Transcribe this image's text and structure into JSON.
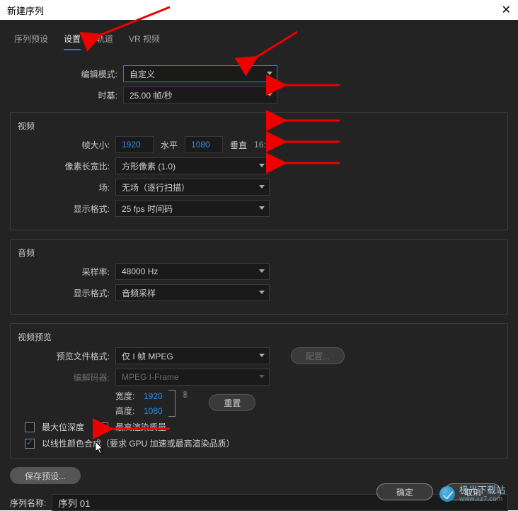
{
  "window": {
    "title": "新建序列",
    "close": "✕"
  },
  "tabs": {
    "presets": "序列预设",
    "settings": "设置",
    "tracks": "轨道",
    "vr": "VR 视频"
  },
  "edit_mode": {
    "label": "编辑模式:",
    "value": "自定义"
  },
  "timebase": {
    "label": "时基:",
    "value": "25.00 帧/秒"
  },
  "video": {
    "title": "视频",
    "frame_size_label": "帧大小:",
    "width": "1920",
    "horizontal": "水平",
    "height": "1080",
    "vertical": "垂直",
    "aspect": "16:9",
    "par_label": "像素长宽比:",
    "par_value": "方形像素 (1.0)",
    "fields_label": "场:",
    "fields_value": "无场（逐行扫描）",
    "display_format_label": "显示格式:",
    "display_format_value": "25 fps 时间码"
  },
  "audio": {
    "title": "音频",
    "sample_rate_label": "采样率:",
    "sample_rate_value": "48000 Hz",
    "display_format_label": "显示格式:",
    "display_format_value": "音频采样"
  },
  "preview": {
    "title": "视频预览",
    "file_format_label": "预览文件格式:",
    "file_format_value": "仅 I 帧 MPEG",
    "codec_label": "编解码器:",
    "codec_value": "MPEG I-Frame",
    "width_label": "宽度:",
    "width_value": "1920",
    "height_label": "高度:",
    "height_value": "1080",
    "config": "配置...",
    "reset": "重置",
    "link_icon": "𝟠"
  },
  "checkboxes": {
    "max_bit_depth": "最大位深度",
    "max_render_quality": "最高渲染质量",
    "linear_color": "以线性颜色合成（要求 GPU 加速或最高渲染品质）"
  },
  "save_preset": "保存预设...",
  "sequence_name_label": "序列名称:",
  "sequence_name_value": "序列 01",
  "ok": "确定",
  "cancel": "取消",
  "watermark": {
    "line1": "极光下载站",
    "line2": "www.xz7.com"
  }
}
